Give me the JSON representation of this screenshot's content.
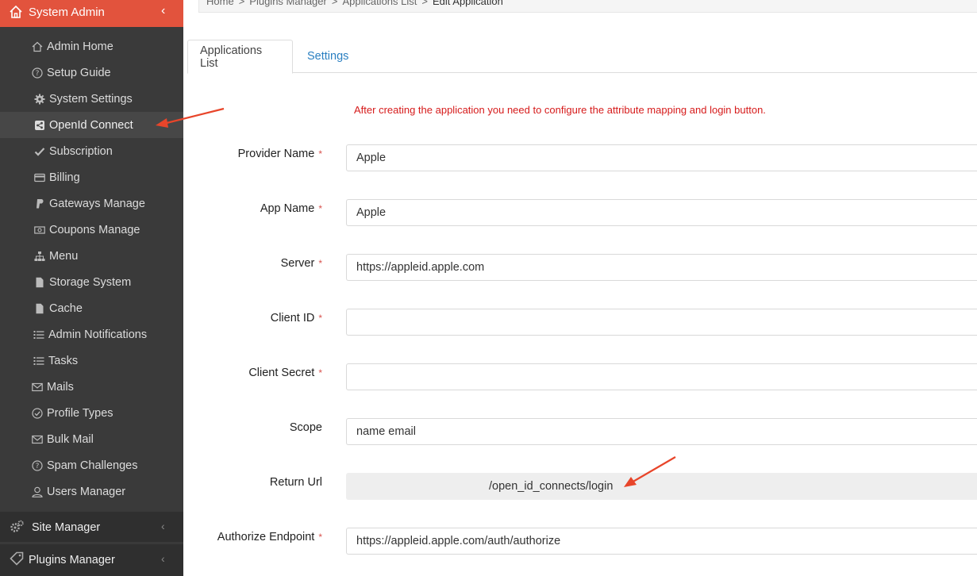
{
  "sidebar": {
    "title": "System Admin",
    "items": [
      {
        "label": "Admin Home",
        "icon": "home-outline-icon"
      },
      {
        "label": "Setup Guide",
        "icon": "question-circle-icon"
      },
      {
        "label": "System Settings",
        "icon": "gear-icon"
      },
      {
        "label": "OpenId Connect",
        "icon": "share-square-icon",
        "active": true
      },
      {
        "label": "Subscription",
        "icon": "check-icon"
      },
      {
        "label": "Billing",
        "icon": "credit-card-icon"
      },
      {
        "label": "Gateways Manage",
        "icon": "paypal-icon"
      },
      {
        "label": "Coupons Manage",
        "icon": "money-bill-icon"
      },
      {
        "label": "Menu",
        "icon": "sitemap-icon"
      },
      {
        "label": "Storage System",
        "icon": "file-icon"
      },
      {
        "label": "Cache",
        "icon": "file-icon"
      },
      {
        "label": "Admin Notifications",
        "icon": "list-icon"
      },
      {
        "label": "Tasks",
        "icon": "list-icon"
      },
      {
        "label": "Mails",
        "icon": "envelope-icon"
      },
      {
        "label": "Profile Types",
        "icon": "check-circle-icon"
      },
      {
        "label": "Bulk Mail",
        "icon": "envelope-icon"
      },
      {
        "label": "Spam Challenges",
        "icon": "question-circle-icon"
      },
      {
        "label": "Users Manager",
        "icon": "user-icon"
      }
    ],
    "sections": [
      {
        "label": "Site Manager",
        "icon": "gears-icon"
      },
      {
        "label": "Plugins Manager",
        "icon": "tag-icon"
      }
    ]
  },
  "breadcrumb": {
    "items": [
      "Home",
      ">",
      "Plugins Manager",
      ">",
      "Applications List",
      ">"
    ],
    "current": "Edit Application"
  },
  "tabs": {
    "applications_list": "Applications List",
    "settings": "Settings"
  },
  "notice": "After creating the application you need to configure the attribute mapping and login button.",
  "form": {
    "provider_name": {
      "label": "Provider Name",
      "value": "Apple",
      "required": "*"
    },
    "app_name": {
      "label": "App Name",
      "value": "Apple",
      "required": "*"
    },
    "server": {
      "label": "Server",
      "value": "https://appleid.apple.com",
      "required": "*"
    },
    "client_id": {
      "label": "Client ID",
      "value": "",
      "required": "*"
    },
    "client_secret": {
      "label": "Client Secret",
      "value": "",
      "required": "*"
    },
    "scope": {
      "label": "Scope",
      "value": "name email"
    },
    "return_url": {
      "label": "Return Url",
      "value": "/open_id_connects/login"
    },
    "authorize_endpoint": {
      "label": "Authorize Endpoint",
      "value": "https://appleid.apple.com/auth/authorize",
      "required": "*"
    }
  },
  "colors": {
    "accent": "#e2533d",
    "sidebar_bg": "#3a3a3a",
    "notice": "#d61b1b",
    "link": "#2a7fc1",
    "arrow": "#e8452a"
  }
}
